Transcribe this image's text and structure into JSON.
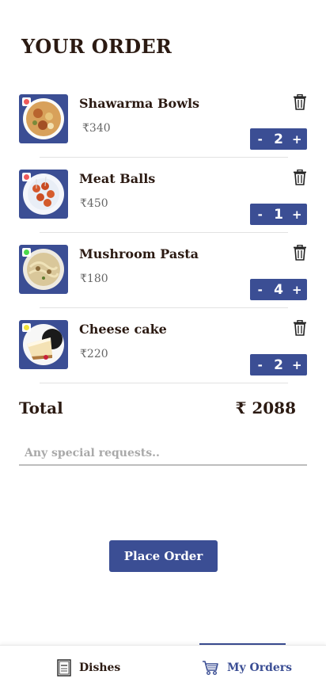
{
  "page_title": "YOUR ORDER",
  "items": [
    {
      "name": "Shawarma Bowls",
      "price": "₹340",
      "qty": "2",
      "dot_color": "#f05a5a"
    },
    {
      "name": "Meat Balls",
      "price": "₹450",
      "qty": "1",
      "dot_color": "#f05a5a"
    },
    {
      "name": "Mushroom Pasta",
      "price": "₹180",
      "qty": "4",
      "dot_color": "#4cd94c"
    },
    {
      "name": "Cheese cake",
      "price": "₹220",
      "qty": "2",
      "dot_color": "#f2e23c"
    }
  ],
  "stepper": {
    "minus": "-",
    "plus": "+"
  },
  "total": {
    "label": "Total",
    "value": "₹ 2088"
  },
  "requests": {
    "placeholder": "Any special requests.."
  },
  "place_order_label": "Place Order",
  "nav": {
    "dishes_label": "Dishes",
    "orders_label": "My Orders",
    "dishes_icon": "menu-icon",
    "orders_icon": "cart-icon"
  },
  "colors": {
    "accent": "#3b4e94",
    "text": "#2b1a12"
  }
}
